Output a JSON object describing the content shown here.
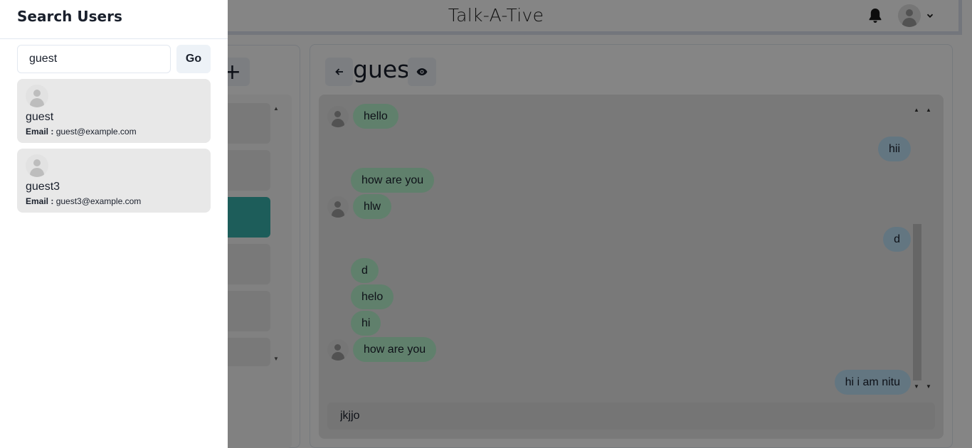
{
  "app": {
    "title": "Talk-A-Tive"
  },
  "chat": {
    "name": "guest",
    "input_value": "jkjjo",
    "messages": [
      {
        "text": "hello",
        "from": "them",
        "avatar": true
      },
      {
        "text": "hii",
        "from": "me",
        "avatar": false
      },
      {
        "text": "how are you",
        "from": "them",
        "avatar": false
      },
      {
        "text": "hlw",
        "from": "them",
        "avatar": true
      },
      {
        "text": "d",
        "from": "me",
        "avatar": false
      },
      {
        "text": "d",
        "from": "them",
        "avatar": false
      },
      {
        "text": "helo",
        "from": "them",
        "avatar": false
      },
      {
        "text": "hi",
        "from": "them",
        "avatar": false
      },
      {
        "text": "how are you",
        "from": "them",
        "avatar": true
      },
      {
        "text": "hi i am nitu",
        "from": "me",
        "avatar": false
      }
    ]
  },
  "drawer": {
    "title": "Search Users",
    "search_value": "guest",
    "go_label": "Go",
    "email_label": "Email :",
    "results": [
      {
        "name": "guest",
        "email": "guest@example.com"
      },
      {
        "name": "guest3",
        "email": "guest3@example.com"
      }
    ]
  },
  "colors": {
    "selected_chat": "#38b2ac",
    "incoming_bubble": "#b9f5d0",
    "outgoing_bubble": "#bee3f8"
  },
  "icons": [
    "bell-icon",
    "user-avatar-icon",
    "chevron-down-icon",
    "plus-icon",
    "arrow-left-icon",
    "eye-icon",
    "scroll-up-icon",
    "scroll-down-icon"
  ]
}
